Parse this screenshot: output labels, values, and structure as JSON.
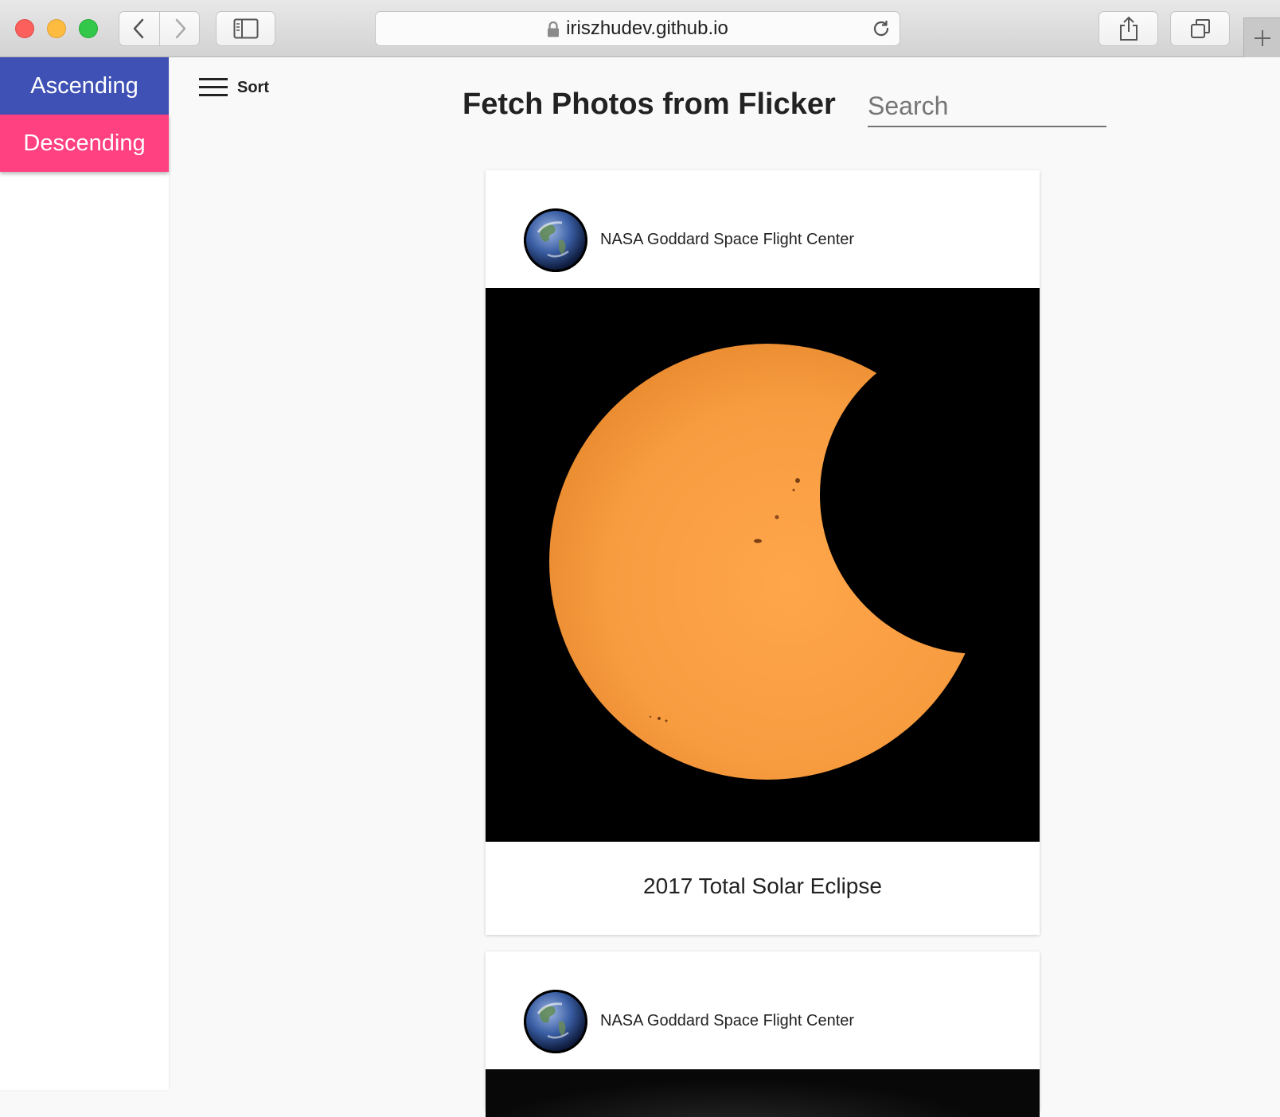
{
  "browser": {
    "url": "iriszhudev.github.io",
    "icons": {
      "back": "chevron-left-icon",
      "forward": "chevron-right-icon",
      "sidebar": "sidebar-icon",
      "lock": "lock-icon",
      "reload": "reload-icon",
      "share": "share-icon",
      "tabs": "tabs-icon",
      "new_tab": "plus-icon"
    }
  },
  "drawer": {
    "ascending_label": "Ascending",
    "descending_label": "Descending",
    "colors": {
      "ascending": "#3f51b5",
      "descending": "#ff4081"
    }
  },
  "toolbar": {
    "sort_label": "Sort",
    "title": "Fetch Photos from Flicker",
    "search_placeholder": "Search"
  },
  "photos": [
    {
      "author": "NASA Goddard Space Flight Center",
      "caption": "2017 Total Solar Eclipse"
    },
    {
      "author": "NASA Goddard Space Flight Center",
      "caption": ""
    }
  ]
}
